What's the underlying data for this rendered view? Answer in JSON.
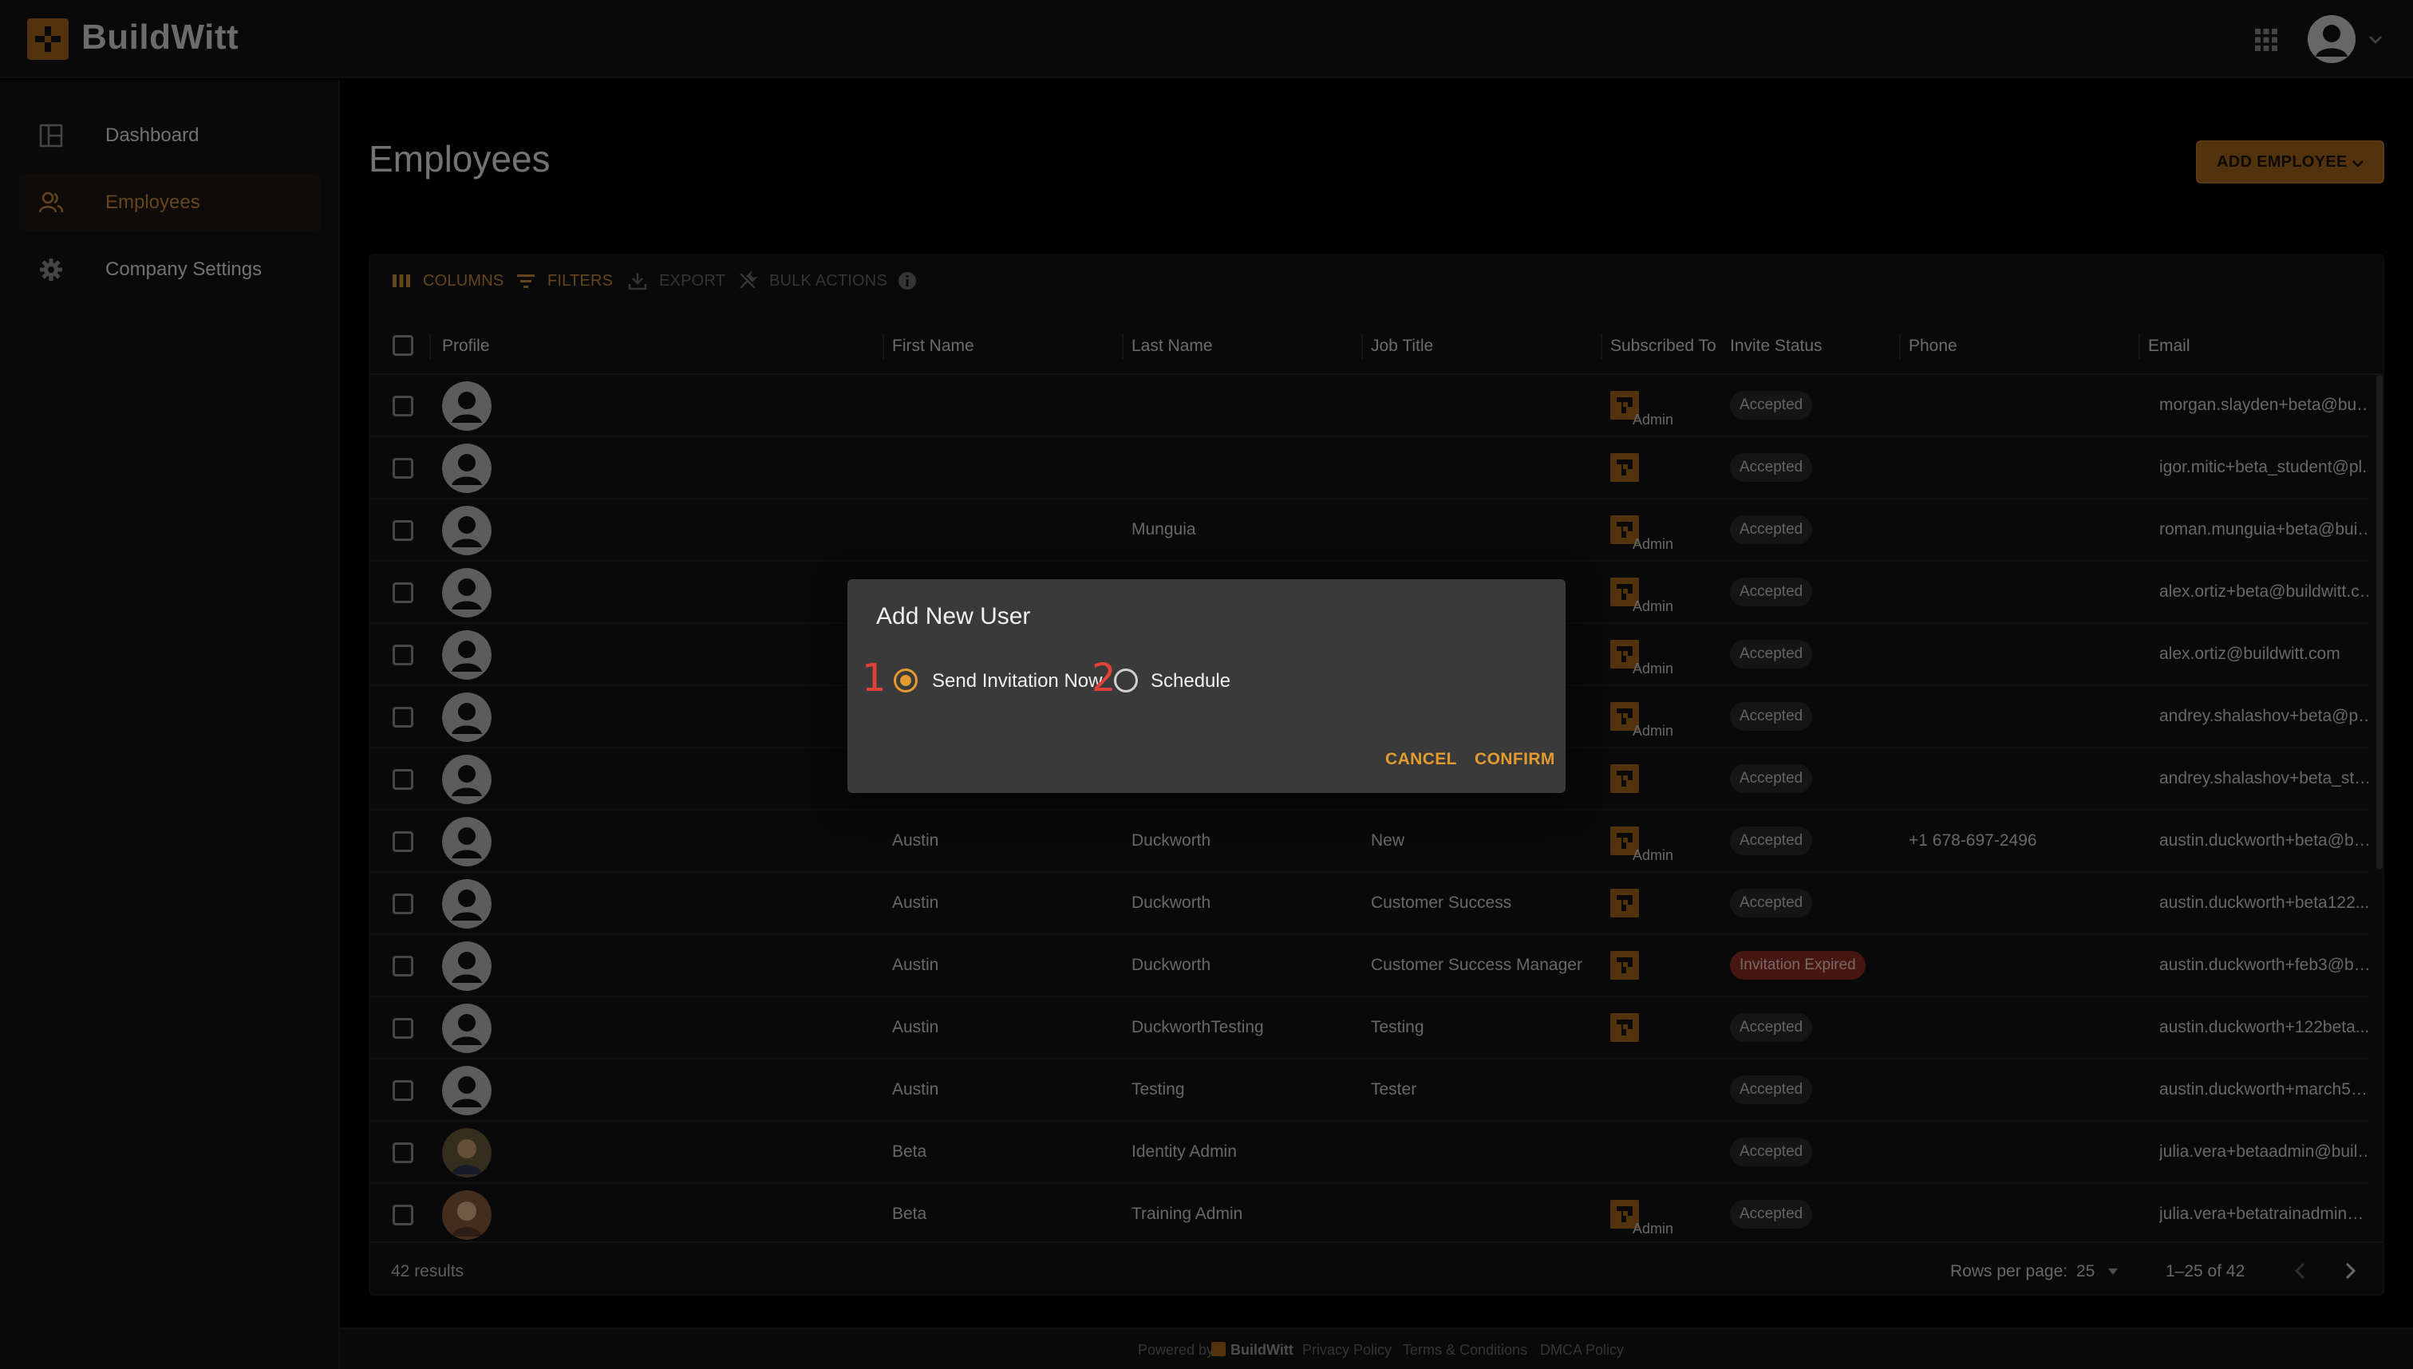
{
  "app": {
    "brand": "BuildWitt"
  },
  "sidebar": {
    "items": [
      {
        "label": "Dashboard",
        "icon": "dashboard-icon",
        "active": false
      },
      {
        "label": "Employees",
        "icon": "people-icon",
        "active": true
      },
      {
        "label": "Company Settings",
        "icon": "gear-icon",
        "active": false
      }
    ]
  },
  "page": {
    "title": "Employees",
    "add_button": "ADD EMPLOYEE"
  },
  "toolbar": {
    "columns": "COLUMNS",
    "filters": "FILTERS",
    "export": "EXPORT",
    "bulk_actions": "BULK ACTIONS"
  },
  "table": {
    "headers": [
      "Profile",
      "First Name",
      "Last Name",
      "Job Title",
      "Subscribed To",
      "Invite Status",
      "Phone",
      "Email"
    ],
    "rows": [
      {
        "first": "",
        "last": "",
        "job": "",
        "sub": true,
        "role": "Admin",
        "status": "Accepted",
        "phone": "",
        "email": "morgan.slayden+beta@buil..."
      },
      {
        "first": "",
        "last": "",
        "job": "",
        "sub": true,
        "role": "",
        "status": "Accepted",
        "phone": "",
        "email": "igor.mitic+beta_student@pl..."
      },
      {
        "first": "",
        "last": "Munguia",
        "job": "",
        "sub": true,
        "role": "Admin",
        "status": "Accepted",
        "phone": "",
        "email": "roman.munguia+beta@build..."
      },
      {
        "first": "",
        "last": "",
        "job": "",
        "sub": true,
        "role": "Admin",
        "status": "Accepted",
        "phone": "",
        "email": "alex.ortiz+beta@buildwitt.co..."
      },
      {
        "first": "",
        "last": "",
        "job": "",
        "sub": true,
        "role": "Admin",
        "status": "Accepted",
        "phone": "",
        "email": "alex.ortiz@buildwitt.com"
      },
      {
        "first": "",
        "last": "",
        "job": "",
        "sub": true,
        "role": "Admin",
        "status": "Accepted",
        "phone": "",
        "email": "andrey.shalashov+beta@plu..."
      },
      {
        "first": "",
        "last": "",
        "job": "",
        "sub": true,
        "role": "",
        "status": "Accepted",
        "phone": "",
        "email": "andrey.shalashov+beta_stu..."
      },
      {
        "first": "Austin",
        "last": "Duckworth",
        "job": "New",
        "sub": true,
        "role": "Admin",
        "status": "Accepted",
        "phone": "+1 678-697-2496",
        "email": "austin.duckworth+beta@bui..."
      },
      {
        "first": "Austin",
        "last": "Duckworth",
        "job": "Customer Success",
        "sub": true,
        "role": "",
        "status": "Accepted",
        "phone": "",
        "email": "austin.duckworth+beta122..."
      },
      {
        "first": "Austin",
        "last": "Duckworth",
        "job": "Customer Success Manager",
        "sub": true,
        "role": "",
        "status": "Invitation Expired",
        "phone": "",
        "email": "austin.duckworth+feb3@bui..."
      },
      {
        "first": "Austin",
        "last": "DuckworthTesting",
        "job": "Testing",
        "sub": true,
        "role": "",
        "status": "Accepted",
        "phone": "",
        "email": "austin.duckworth+122beta..."
      },
      {
        "first": "Austin",
        "last": "Testing",
        "job": "Tester",
        "sub": false,
        "role": "",
        "status": "Accepted",
        "phone": "",
        "email": "austin.duckworth+march5@..."
      },
      {
        "first": "Beta",
        "last": "Identity Admin",
        "job": "",
        "sub": false,
        "role": "",
        "status": "Accepted",
        "phone": "",
        "email": "julia.vera+betaadmin@build..."
      },
      {
        "first": "Beta",
        "last": "Training Admin",
        "job": "",
        "sub": true,
        "role": "Admin",
        "status": "Accepted",
        "phone": "",
        "email": "julia.vera+betatrainadmin@..."
      }
    ]
  },
  "pagination": {
    "results": "42 results",
    "rows_per_page_label": "Rows per page:",
    "rows_per_page": "25",
    "range": "1–25 of 42"
  },
  "footer": {
    "powered_by": "Powered by",
    "brand": "BuildWitt",
    "privacy": "Privacy Policy",
    "terms": "Terms & Conditions",
    "dmca": "DMCA Policy"
  },
  "dialog": {
    "title": "Add New User",
    "option1": "Send Invitation Now",
    "option2": "Schedule",
    "marker1": "1",
    "marker2": "2",
    "cancel": "CANCEL",
    "confirm": "CONFIRM"
  },
  "colors": {
    "accent": "#c88a3a",
    "brand": "#a5661d",
    "radio_active": "#e39a2f",
    "expired": "#8e2c22"
  }
}
